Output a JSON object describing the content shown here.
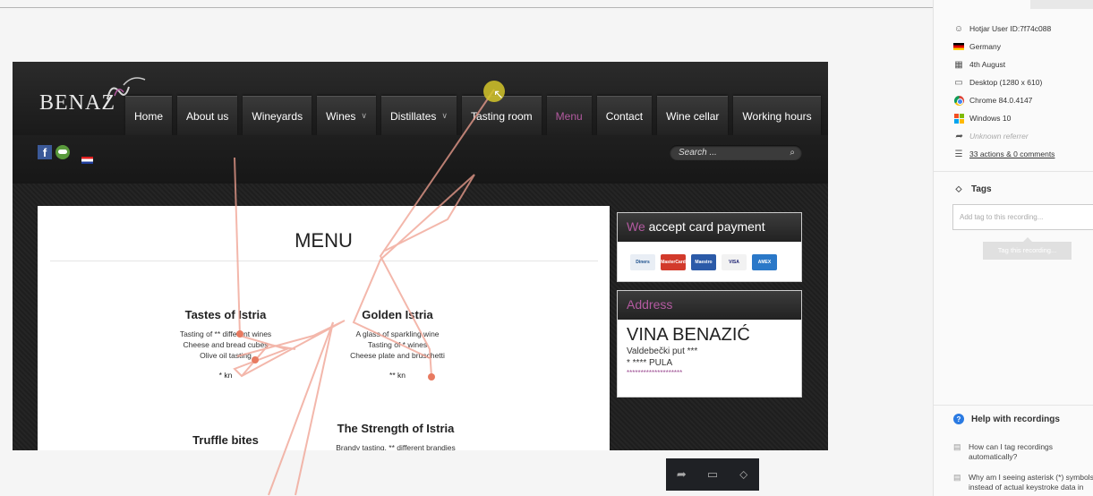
{
  "site": {
    "logo_text": "BENAZ",
    "nav": [
      {
        "label": "Home",
        "dropdown": false
      },
      {
        "label": "About us",
        "dropdown": false
      },
      {
        "label": "Wineyards",
        "dropdown": false
      },
      {
        "label": "Wines",
        "dropdown": true
      },
      {
        "label": "Distillates",
        "dropdown": true
      },
      {
        "label": "Tasting room",
        "dropdown": false
      },
      {
        "label": "Menu",
        "dropdown": false,
        "active": true
      },
      {
        "label": "Contact",
        "dropdown": false
      },
      {
        "label": "Wine cellar",
        "dropdown": false
      },
      {
        "label": "Working hours",
        "dropdown": false
      }
    ],
    "search_placeholder": "Search ...",
    "facebook_glyph": "f",
    "accent_color": "#b35aa0",
    "content": {
      "title": "MENU",
      "blocks": {
        "tastes": {
          "title": "Tastes of Istria",
          "lines": [
            "Tasting of ** different wines",
            "Cheese and bread cubes",
            "Olive oil tasting"
          ],
          "price": "* kn"
        },
        "golden": {
          "title": "Golden Istria",
          "lines": [
            "A glass of sparkling wine",
            "Tasting of * wines",
            "Cheese plate and bruschetti"
          ],
          "price": "** kn"
        },
        "truffle": {
          "title": "Truffle bites"
        },
        "strength": {
          "title": "The Strength of Istria",
          "lines": [
            "Brandy tasting, ** different brandies"
          ]
        }
      }
    },
    "card_widget": {
      "accent": "We",
      "title": " accept card payment",
      "cards": [
        {
          "name": "diners-card",
          "label": "Diners",
          "color": "#e9eef5",
          "text": "#1b4f8c"
        },
        {
          "name": "mastercard-card",
          "label": "MasterCard",
          "color": "#d23a2b",
          "text": "#fff"
        },
        {
          "name": "maestro-card",
          "label": "Maestro",
          "color": "#2b5aa8",
          "text": "#fff"
        },
        {
          "name": "visa-card",
          "label": "VISA",
          "color": "#f2f2f2",
          "text": "#1a1f71"
        },
        {
          "name": "amex-card",
          "label": "AMEX",
          "color": "#2a78c8",
          "text": "#fff"
        }
      ]
    },
    "address_widget": {
      "title": "Address",
      "name": "VINA BENAZIĆ",
      "street": "Valdebečki put ***",
      "city": "* **** PULA",
      "email": "********************"
    }
  },
  "toolbar": {
    "share_icon": "share-icon",
    "comment_icon": "comment-icon",
    "tag_icon": "tag-icon"
  },
  "panel": {
    "meta": {
      "user_id": "Hotjar User ID:7f74c088",
      "country": "Germany",
      "date": "4th August",
      "device": "Desktop (1280 x 610)",
      "browser": "Chrome 84.0.4147",
      "os": "Windows 10",
      "referrer": "Unknown referrer",
      "actions": "33 actions & 0 comments"
    },
    "tags": {
      "heading": "Tags",
      "placeholder": "Add tag to this recording...",
      "button": "Tag this recording..."
    },
    "help": {
      "heading": "Help with recordings",
      "items": [
        "How can I tag recordings automatically?",
        "Why am I seeing asterisk (*) symbols instead of actual keystroke data in"
      ]
    }
  }
}
